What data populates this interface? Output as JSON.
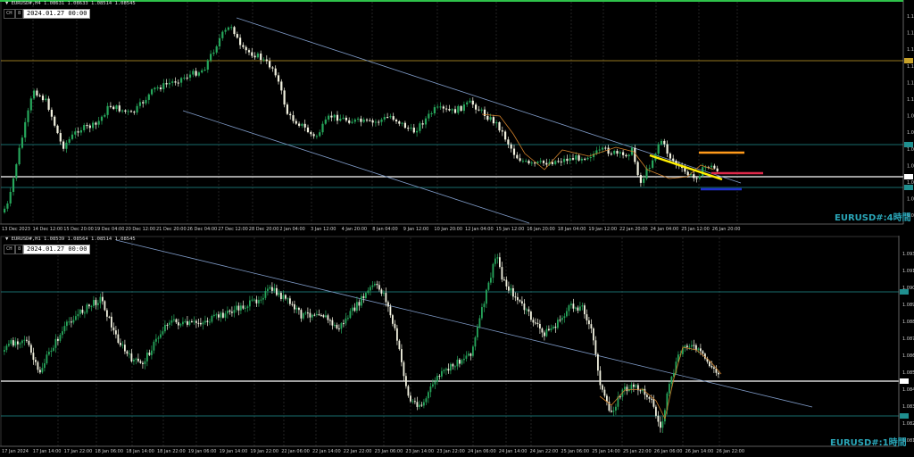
{
  "colors": {
    "background": "#000000",
    "bull": "#26a65b",
    "bear": "#f2f2e0",
    "trendline": "#7f9bc8",
    "hline_cyan": "#1f8f8f",
    "hline_white": "#ffffff",
    "hline_gold": "#c8a22a",
    "yellow_line": "#ffef00",
    "orange_line": "#ff9a1a",
    "red_line": "#e0284a",
    "blue_line": "#2030d0",
    "ma": "#d0802a",
    "border_green": "#2ec24a"
  },
  "top_panel": {
    "header": "▼ EURUSD#,H4  1.08631 1.08633 1.08514 1.08545",
    "ctrl_label": "CH",
    "ctrl_num": "8",
    "datetime": "2024.01.27 00:00",
    "timeframe_label": "EURUSD#:4時間",
    "x_labels": [
      "13 Dec 2023",
      "14 Dec 12:00",
      "15 Dec 20:00",
      "19 Dec 04:00",
      "20 Dec 12:00",
      "21 Dec 20:00",
      "26 Dec 04:00",
      "27 Dec 12:00",
      "28 Dec 20:00",
      "2 Jan 04:00",
      "3 Jan 12:00",
      "4 Jan 20:00",
      "8 Jan 04:00",
      "9 Jan 12:00",
      "10 Jan 20:00",
      "12 Jan 04:00",
      "15 Jan 12:00",
      "16 Jan 20:00",
      "18 Jan 04:00",
      "19 Jan 12:00",
      "22 Jan 20:00",
      "24 Jan 04:00",
      "25 Jan 12:00",
      "26 Jan 20:00"
    ],
    "price_labels": [
      "1.1",
      "1.1",
      "1.1",
      "1.1",
      "1.1",
      "1.1",
      "1.0",
      "1.0",
      "1.0",
      "1.0",
      "1.0",
      "1.0",
      "1.0"
    ]
  },
  "bottom_panel": {
    "header": "▼ EURUSD#,H1  1.08539 1.08564 1.08514 1.08545",
    "ctrl_label": "CH",
    "ctrl_num": "8",
    "datetime": "2024.01.27 00:00",
    "timeframe_label": "EURUSD#:1時間",
    "x_labels": [
      "17 Jan 2024",
      "17 Jan 14:00",
      "17 Jan 22:00",
      "18 Jan 06:00",
      "18 Jan 14:00",
      "18 Jan 22:00",
      "19 Jan 06:00",
      "19 Jan 14:00",
      "19 Jan 22:00",
      "22 Jan 06:00",
      "22 Jan 14:00",
      "22 Jan 22:00",
      "23 Jan 06:00",
      "23 Jan 14:00",
      "23 Jan 22:00",
      "24 Jan 06:00",
      "24 Jan 14:00",
      "24 Jan 22:00",
      "25 Jan 06:00",
      "25 Jan 14:00",
      "25 Jan 22:00",
      "26 Jan 06:00",
      "26 Jan 14:00",
      "26 Jan 22:00"
    ],
    "price_labels": [
      "1.093",
      "1.091",
      "1.090",
      "1.089",
      "1.088",
      "1.087",
      "1.086",
      "1.085",
      "1.084",
      "1.083",
      "1.082",
      "1.081"
    ]
  }
}
